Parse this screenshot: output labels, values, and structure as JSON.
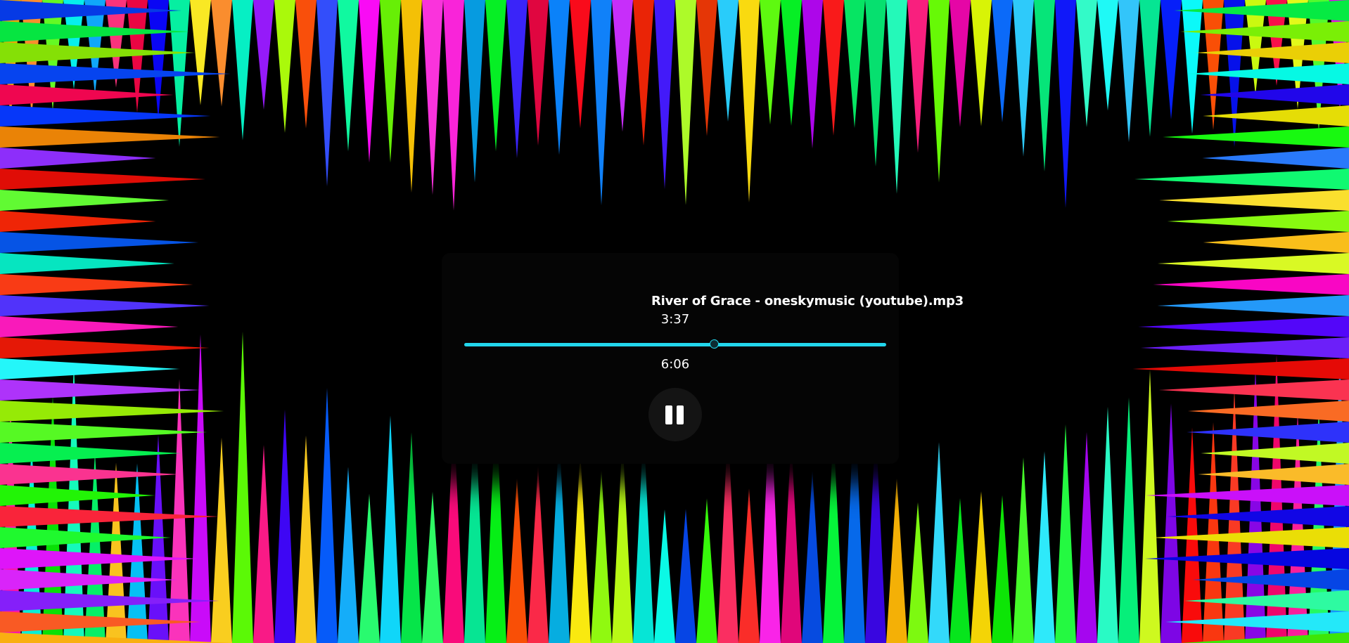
{
  "player": {
    "track_title": "River of Grace - oneskymusic (youtube).mp3",
    "current_time": "3:37",
    "duration": "6:06",
    "progress_fraction": 0.593,
    "state": "playing",
    "button_icon": "pause-icon"
  },
  "colors": {
    "background": "#000000",
    "accent": "#22d6ec",
    "button_bg": "#141414",
    "text": "#ffffff"
  },
  "visualizer": {
    "style": "radial spikes",
    "palette": [
      "#ff0000",
      "#ff7f00",
      "#ffff00",
      "#7fff00",
      "#00ff00",
      "#00ff7f",
      "#00ffff",
      "#007fff",
      "#0000ff",
      "#7f00ff",
      "#ff00ff",
      "#ff007f"
    ]
  }
}
